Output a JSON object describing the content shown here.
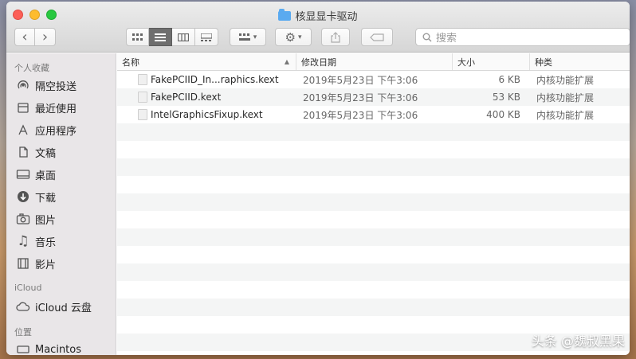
{
  "window": {
    "title": "核显显卡驱动"
  },
  "toolbar": {
    "back_label": "‹",
    "forward_label": "›",
    "search_placeholder": "搜索"
  },
  "sidebar": {
    "sections": [
      {
        "title": "个人收藏",
        "items": [
          {
            "label": "隔空投送",
            "icon": "airdrop-icon"
          },
          {
            "label": "最近使用",
            "icon": "recents-icon"
          },
          {
            "label": "应用程序",
            "icon": "applications-icon"
          },
          {
            "label": "文稿",
            "icon": "documents-icon"
          },
          {
            "label": "桌面",
            "icon": "desktop-icon"
          },
          {
            "label": "下载",
            "icon": "downloads-icon"
          },
          {
            "label": "图片",
            "icon": "pictures-icon"
          },
          {
            "label": "音乐",
            "icon": "music-icon"
          },
          {
            "label": "影片",
            "icon": "movies-icon"
          }
        ]
      },
      {
        "title": "iCloud",
        "items": [
          {
            "label": "iCloud 云盘",
            "icon": "cloud-icon"
          }
        ]
      },
      {
        "title": "位置",
        "items": [
          {
            "label": "Macintos",
            "icon": "disk-icon"
          }
        ]
      }
    ]
  },
  "columns": {
    "name": "名称",
    "date": "修改日期",
    "size": "大小",
    "kind": "种类"
  },
  "files": [
    {
      "name": "FakePCIID_In...raphics.kext",
      "date": "2019年5月23日 下午3:06",
      "size": "6 KB",
      "kind": "内核功能扩展"
    },
    {
      "name": "FakePCIID.kext",
      "date": "2019年5月23日 下午3:06",
      "size": "53 KB",
      "kind": "内核功能扩展"
    },
    {
      "name": "IntelGraphicsFixup.kext",
      "date": "2019年5月23日 下午3:06",
      "size": "400 KB",
      "kind": "内核功能扩展"
    }
  ],
  "footer_watermark": "头条 @魏叔黑果"
}
